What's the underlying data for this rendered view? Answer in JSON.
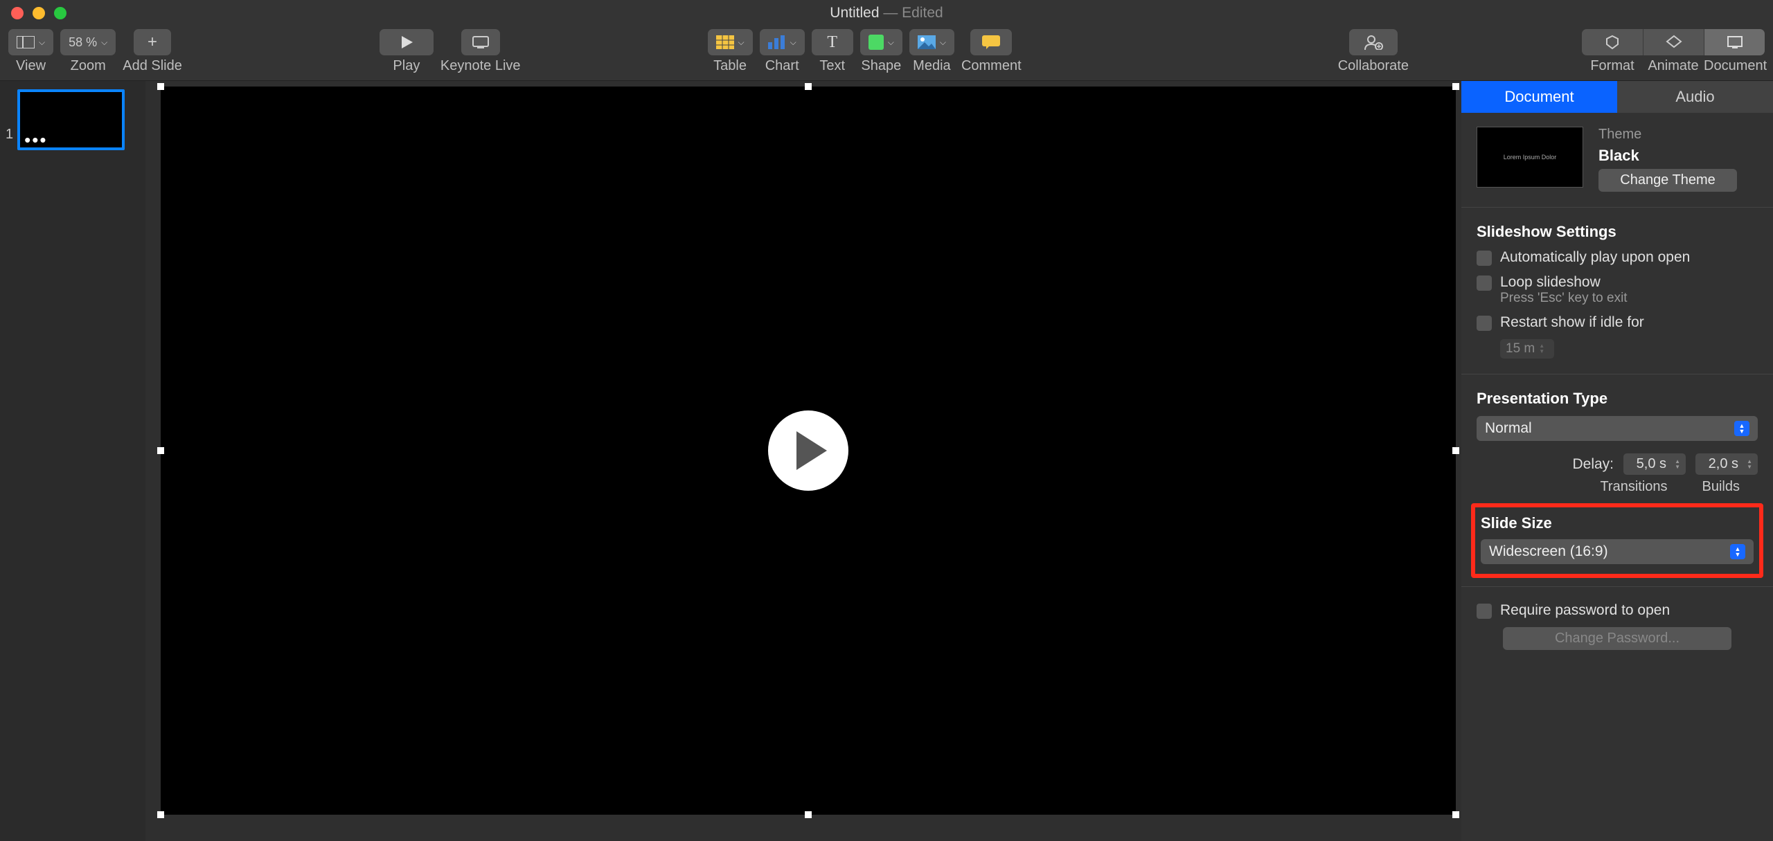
{
  "titlebar": {
    "name": "Untitled",
    "status": " — Edited"
  },
  "toolbar": {
    "view": "View",
    "zoom": "Zoom",
    "zoom_value": "58 %",
    "add_slide": "Add Slide",
    "play": "Play",
    "keynote_live": "Keynote Live",
    "table": "Table",
    "chart": "Chart",
    "text": "Text",
    "shape": "Shape",
    "media": "Media",
    "comment": "Comment",
    "collaborate": "Collaborate",
    "format": "Format",
    "animate": "Animate",
    "document": "Document"
  },
  "navigator": {
    "slide1_num": "1"
  },
  "inspector": {
    "tabs": {
      "document": "Document",
      "audio": "Audio"
    },
    "theme": {
      "label": "Theme",
      "name": "Black",
      "change": "Change Theme",
      "thumb_text": "Lorem Ipsum Dolor"
    },
    "slideshow": {
      "title": "Slideshow Settings",
      "auto_play": "Automatically play upon open",
      "loop": "Loop slideshow",
      "loop_sub": "Press 'Esc' key to exit",
      "restart": "Restart show if idle for",
      "restart_val": "15 m"
    },
    "presentation_type": {
      "title": "Presentation Type",
      "value": "Normal",
      "delay_label": "Delay:",
      "transitions_val": "5,0 s",
      "builds_val": "2,0 s",
      "transitions": "Transitions",
      "builds": "Builds"
    },
    "slide_size": {
      "title": "Slide Size",
      "value": "Widescreen (16:9)"
    },
    "password": {
      "label": "Require password to open",
      "change": "Change Password..."
    }
  }
}
